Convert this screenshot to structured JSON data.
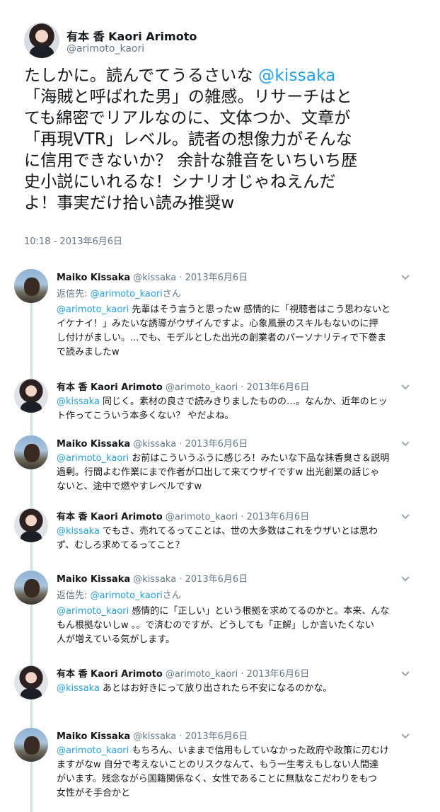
{
  "main_tweet": {
    "name": "有本 香 Kaori Arimoto",
    "handle": "@arimoto_kaori",
    "text_lines": [
      {
        "pre": "たしかに。読んでてうるさいな ",
        "mention": "@kissaka"
      },
      {
        "pre": "「海賊と呼ばれた男」の雑感。リサーチはと",
        "mention": ""
      },
      {
        "pre": "ても綿密でリアルなのに、文体つか、文章が",
        "mention": ""
      },
      {
        "pre": "「再現VTR」レベル。読者の想像力がそんな",
        "mention": ""
      },
      {
        "pre": "に信用できないか？ 余計な雑音をいちいち歴",
        "mention": ""
      },
      {
        "pre": "史小説にいれるな！シナリオじゃねえんだ",
        "mention": ""
      },
      {
        "pre": "よ！事実だけ拾い読み推奨w",
        "mention": ""
      }
    ],
    "timestamp": "10:18 - 2013年6月6日"
  },
  "replies": [
    {
      "avatar": "maiko",
      "name": "Maiko Kissaka",
      "meta": "@kissaka · 2013年6月6日",
      "reply_to_prefix": "返信先: ",
      "reply_to_mention": "@arimoto_kaori",
      "reply_to_suffix": "さん",
      "lines": [
        {
          "mention": "@arimoto_kaori",
          "text": " 先輩はそう言うと思ったw 感情的に「視聴者はこう思わないと"
        },
        {
          "mention": "",
          "text": "イケナイ！」みたいな誘導がウザイんですよ。心象風景のスキルもないのに押"
        },
        {
          "mention": "",
          "text": "し付けがましい。...でも、モデルとした出光の創業者のパーソナリティで下巻ま"
        },
        {
          "mention": "",
          "text": "で読みましたw"
        }
      ]
    },
    {
      "avatar": "kaori",
      "name": "有本 香 Kaori Arimoto",
      "meta": "@arimoto_kaori · 2013年6月6日",
      "lines": [
        {
          "mention": "@kissaka",
          "text": " 同じく。素材の良さで読みきりましたものの…。なんか、近年のヒッ"
        },
        {
          "mention": "",
          "text": "ト作ってこういう本多くない？ やだよね。"
        }
      ]
    },
    {
      "avatar": "maiko",
      "name": "Maiko Kissaka",
      "meta": "@kissaka · 2013年6月6日",
      "lines": [
        {
          "mention": "@arimoto_kaori",
          "text": " お前はこういうふうに感じろ！みたいな下品な抹香臭さ＆説明"
        },
        {
          "mention": "",
          "text": "過剰。行間よむ作業にまで作者が口出して来てウザイですw 出光創業の話じゃ"
        },
        {
          "mention": "",
          "text": "ないと、途中で燃やすレベルですw"
        }
      ]
    },
    {
      "avatar": "kaori",
      "name": "有本 香 Kaori Arimoto",
      "meta": "@arimoto_kaori · 2013年6月6日",
      "lines": [
        {
          "mention": "@kissaka",
          "text": " でもさ、売れてるってことは、世の大多数はこれをウザいとは思わ"
        },
        {
          "mention": "",
          "text": "ず、むしろ求めてるってこと？"
        }
      ]
    },
    {
      "avatar": "maiko",
      "name": "Maiko Kissaka",
      "meta": "@kissaka · 2013年6月6日",
      "reply_to_prefix": "返信先: ",
      "reply_to_mention": "@arimoto_kaori",
      "reply_to_suffix": "さん",
      "lines": [
        {
          "mention": "@arimoto_kaori",
          "text": " 感情的に「正しい」という根拠を求めてるのかと。本来、んな"
        },
        {
          "mention": "",
          "text": "もん根拠ないしw 。。で済むのですが、どうしても「正解」しか言いたくない"
        },
        {
          "mention": "",
          "text": "人が増えている気がします。"
        }
      ]
    },
    {
      "avatar": "kaori",
      "name": "有本 香 Kaori Arimoto",
      "meta": "@arimoto_kaori · 2013年6月6日",
      "lines": [
        {
          "mention": "@kissaka",
          "text": " あとはお好きにって放り出されたら不安になるのかな。"
        }
      ]
    },
    {
      "avatar": "maiko",
      "name": "Maiko Kissaka",
      "meta": "@kissaka · 2013年6月6日",
      "lines": [
        {
          "mention": "@arimoto_kaori",
          "text": " もちろん、いままで信用もしていなかった政府や政策に刃むけ"
        },
        {
          "mention": "",
          "text": "ますがなw 自分で考えないことのリスクなんて、もう一生考えもしない人間達"
        },
        {
          "mention": "",
          "text": "がいます。残念ながら国籍関係なく、女性であることに無駄なこだわりをもつ"
        },
        {
          "mention": "",
          "text": "女性がそ手合かと"
        }
      ]
    }
  ]
}
